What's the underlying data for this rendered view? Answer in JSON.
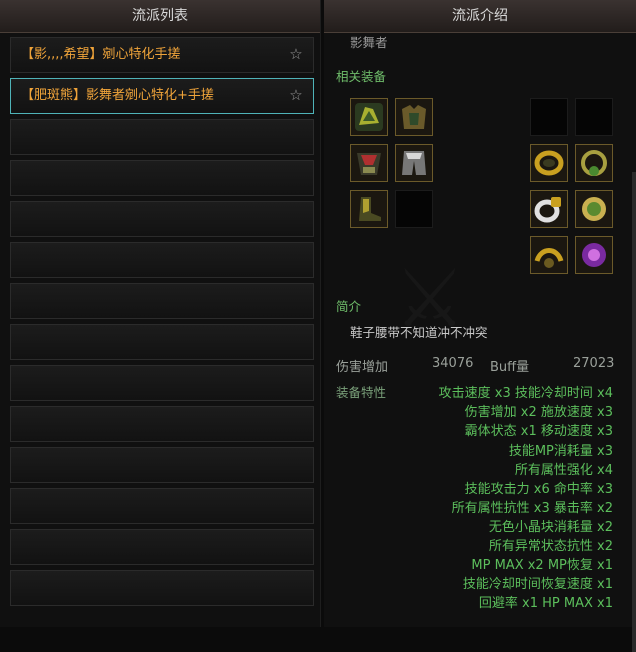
{
  "left_panel": {
    "title": "流派列表",
    "items": [
      {
        "label": "【影,,,,希望】剜心特化手搓",
        "selected": false
      },
      {
        "label": "【肥斑熊】影舞者剜心特化+手搓",
        "selected": true
      }
    ],
    "empty_rows": 12
  },
  "right_panel": {
    "title": "流派介绍",
    "class_name": "影舞者",
    "equip_section_label": "相关装备",
    "intro_label": "简介",
    "intro_text": "鞋子腰带不知道冲不冲突",
    "damage_label": "伤害增加",
    "damage_value": "34076",
    "buff_label": "Buff量",
    "buff_value": "27023",
    "traits_label": "装备特性",
    "traits": [
      "攻击速度 x3   技能冷却时间 x4",
      "伤害增加 x2   施放速度 x3",
      "霸体状态 x1   移动速度 x3",
      "技能MP消耗量 x3",
      "所有属性强化 x4",
      "技能攻击力 x6   命中率 x3",
      "所有属性抗性 x3   暴击率 x2",
      "无色小晶块消耗量 x2",
      "所有异常状态抗性 x2",
      "MP MAX x2   MP恢复 x1",
      "技能冷却时间恢复速度 x1",
      "回避率 x1   HP MAX x1"
    ],
    "equipment_icons": [
      "shoulder-armor-icon",
      "top-armor-icon",
      "belt-armor-icon",
      "pants-armor-icon",
      "shoes-armor-icon",
      "bracelet-icon",
      "necklace-icon",
      "ring-icon",
      "earring-icon",
      "magic-stone-icon",
      "support-icon",
      "weapon-icon"
    ]
  },
  "colors": {
    "item_text": "#f0a43a",
    "green_text": "#6fbd6a",
    "selected_border": "#4fb3b8"
  }
}
